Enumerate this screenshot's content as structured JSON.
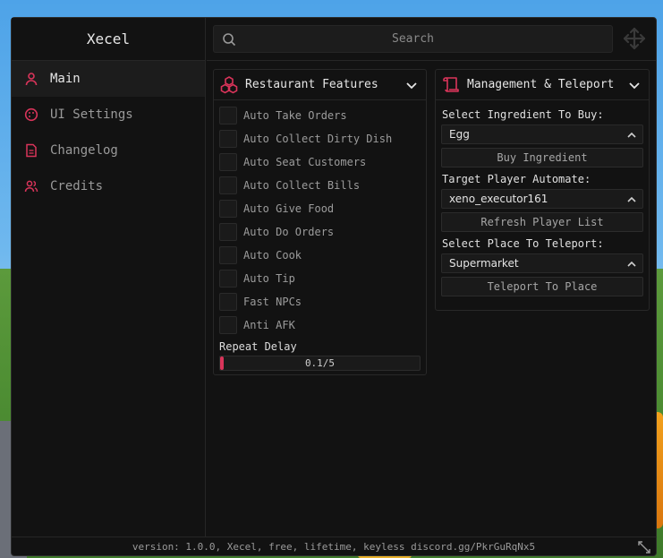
{
  "colors": {
    "accent": "#d9345a",
    "window_bg": "#121212",
    "panel_border": "#282828"
  },
  "app": {
    "title": "Xecel"
  },
  "sidebar": {
    "items": [
      {
        "label": "Main",
        "icon": "user-icon",
        "active": true
      },
      {
        "label": "UI Settings",
        "icon": "palette-icon",
        "active": false
      },
      {
        "label": "Changelog",
        "icon": "document-icon",
        "active": false
      },
      {
        "label": "Credits",
        "icon": "users-icon",
        "active": false
      }
    ]
  },
  "search": {
    "placeholder": "Search"
  },
  "restaurant": {
    "title": "Restaurant Features",
    "toggles": [
      {
        "label": "Auto Take Orders",
        "checked": false
      },
      {
        "label": "Auto Collect Dirty Dish",
        "checked": false
      },
      {
        "label": "Auto Seat Customers",
        "checked": false
      },
      {
        "label": "Auto Collect Bills",
        "checked": false
      },
      {
        "label": "Auto Give Food",
        "checked": false
      },
      {
        "label": "Auto Do Orders",
        "checked": false
      },
      {
        "label": "Auto Cook",
        "checked": false
      },
      {
        "label": "Auto Tip",
        "checked": false
      },
      {
        "label": "Fast NPCs",
        "checked": false
      },
      {
        "label": "Anti AFK",
        "checked": false
      }
    ],
    "slider": {
      "label": "Repeat Delay",
      "value_text": "0.1/5",
      "value": 0.1,
      "max": 5
    }
  },
  "management": {
    "title": "Management & Teleport",
    "ingredient": {
      "label": "Select Ingredient To Buy:",
      "value": "Egg",
      "button": "Buy Ingredient"
    },
    "player": {
      "label": "Target Player Automate:",
      "value": "xeno_executor161",
      "button": "Refresh Player List"
    },
    "place": {
      "label": "Select Place To Teleport:",
      "value": "Supermarket",
      "button": "Teleport To Place"
    }
  },
  "footer": {
    "text": "version: 1.0.0, Xecel, free, lifetime, keyless discord.gg/PkrGuRqNx5"
  }
}
